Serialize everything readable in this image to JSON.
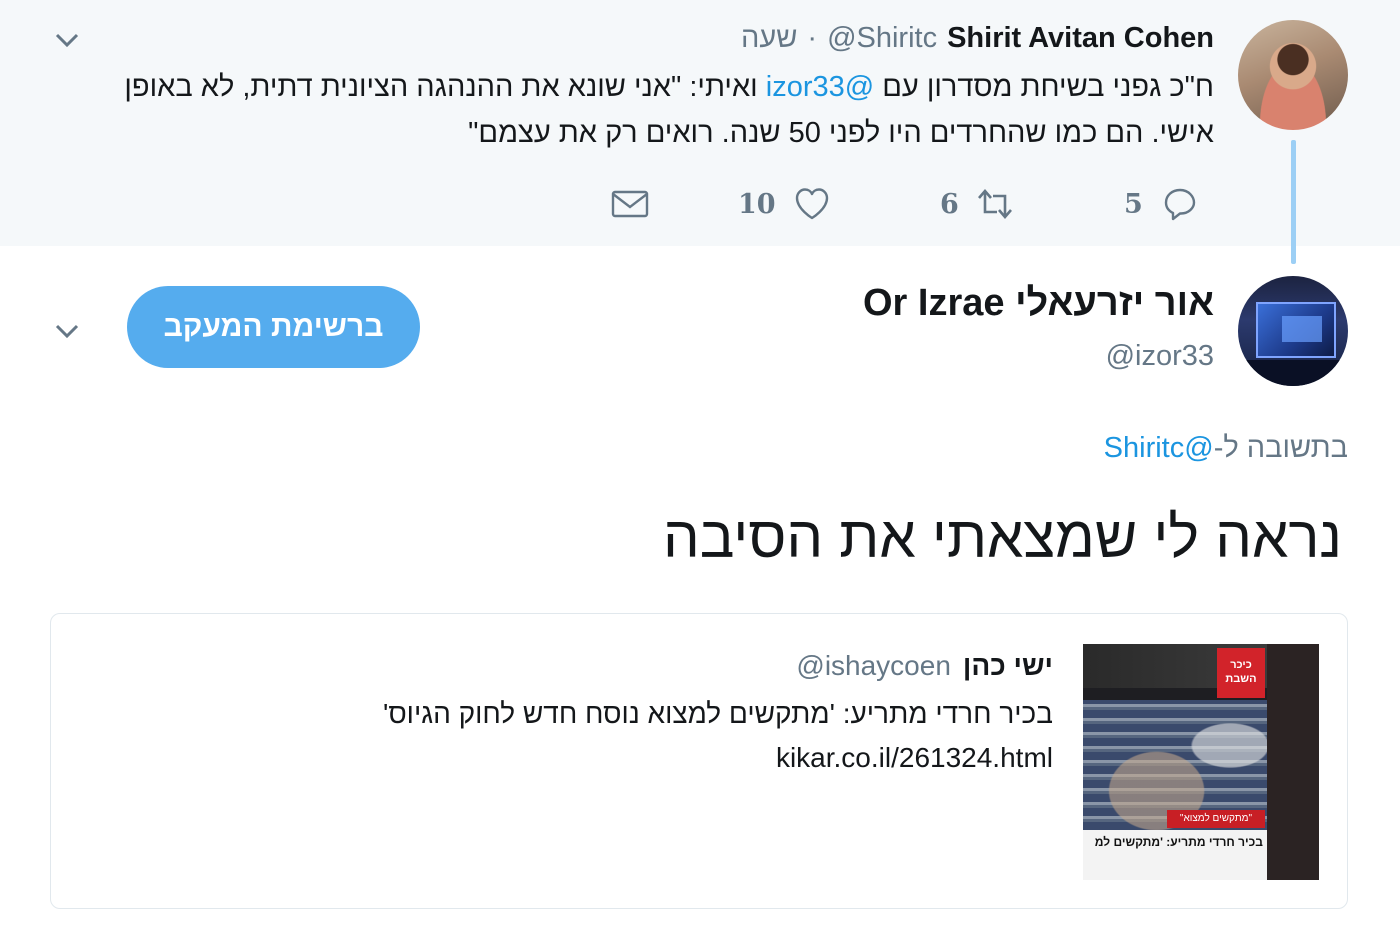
{
  "parent_tweet": {
    "author_name": "Shirit Avitan Cohen",
    "author_handle": "@Shiritc",
    "separator": "·",
    "timestamp": "שעה",
    "text_before_mention": "ח\"כ גפני בשיחת מסדרון עם ",
    "mention": "@izor33",
    "text_after_mention": " ואיתי: \"אני שונא את ההנהגה הציונית דתית, לא באופן אישי. הם כמו שהחרדים היו לפני 50 שנה. רואים רק את עצמם\"",
    "reply_count": "5",
    "retweet_count": "6",
    "like_count": "10",
    "icons": {
      "reply": "reply-icon",
      "retweet": "retweet-icon",
      "like": "heart-icon",
      "dm": "envelope-icon",
      "caret": "chevron-down-icon"
    }
  },
  "main_tweet": {
    "author_name": "אור יזרעאלי Or Izrae",
    "author_handle": "@izor33",
    "follow_button_label": "ברשימת המעקב",
    "reply_to_prefix": "בתשובה ל-",
    "reply_to_handle": "@Shiritc",
    "text": "נראה לי שמצאתי את הסיבה"
  },
  "quoted_tweet": {
    "author_name": "ישי כהן",
    "author_handle": "@ishaycoen",
    "text": "בכיר חרדי מתריע: 'מתקשים למצוא נוסח חדש לחוק הגיוס'",
    "link": "kikar.co.il/261324.html",
    "thumbnail": {
      "logo_text": "כיכר השבת",
      "tag_text": "\"מתקשים למצוא\"",
      "caption_text": "בכיר חרדי מתריע: 'מתקשים למ"
    }
  },
  "colors": {
    "accent": "#1b95e0",
    "follow_button": "#55acee",
    "thread_line": "#9ccff5",
    "muted_text": "#657786",
    "parent_background": "#f5f8fa"
  }
}
